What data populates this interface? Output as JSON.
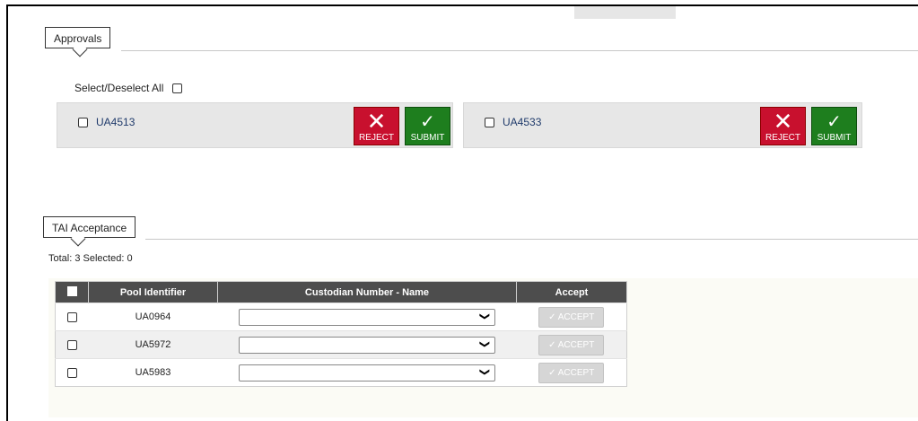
{
  "approvals": {
    "section_label": "Approvals",
    "select_all_label": "Select/Deselect All",
    "cards": [
      {
        "id": "UA4513",
        "reject_label": "REJECT",
        "submit_label": "SUBMIT"
      },
      {
        "id": "UA4533",
        "reject_label": "REJECT",
        "submit_label": "SUBMIT"
      }
    ]
  },
  "tai": {
    "section_label": "TAI Acceptance",
    "total_text": "Total: 3 Selected: 0",
    "columns": [
      "Pool Identifier",
      "Custodian Number - Name",
      "Accept"
    ],
    "rows": [
      {
        "pool": "UA0964",
        "custodian": "",
        "accept_label": "✓ ACCEPT"
      },
      {
        "pool": "UA5972",
        "custodian": "",
        "accept_label": "✓ ACCEPT"
      },
      {
        "pool": "UA5983",
        "custodian": "",
        "accept_label": "✓ ACCEPT"
      }
    ]
  },
  "colors": {
    "reject": "#c8102e",
    "submit": "#1e7e1e",
    "header": "#4d4d4d",
    "link": "#1f3a6b"
  },
  "icons": {
    "reject": "close-icon",
    "submit": "check-icon",
    "dropdown": "chevron-down-icon"
  }
}
